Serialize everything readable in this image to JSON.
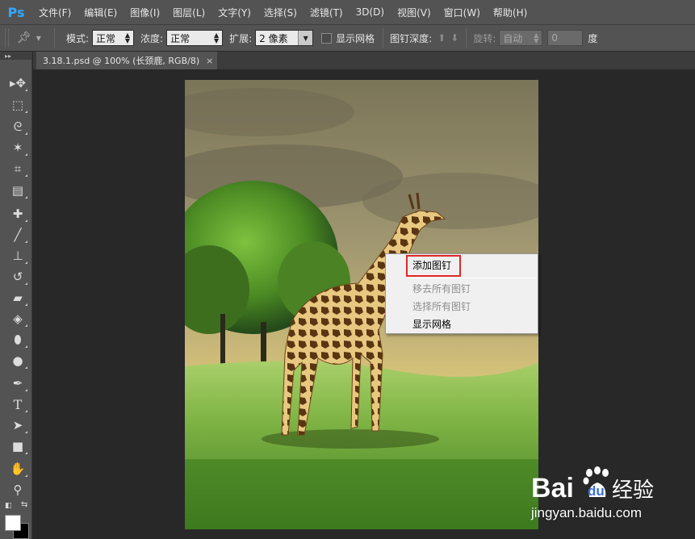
{
  "app": {
    "logo": "Ps"
  },
  "menu": [
    "文件(F)",
    "编辑(E)",
    "图像(I)",
    "图层(L)",
    "文字(Y)",
    "选择(S)",
    "滤镜(T)",
    "3D(D)",
    "视图(V)",
    "窗口(W)",
    "帮助(H)"
  ],
  "options": {
    "mode_label": "模式:",
    "mode_value": "正常",
    "density_label": "浓度:",
    "density_value": "正常",
    "expand_label": "扩展:",
    "expand_value": "2 像素",
    "show_mesh_label": "显示网格",
    "pin_depth_label": "图钉深度:",
    "rotate_label": "旋转:",
    "rotate_value": "自动",
    "rotate_angle": "0",
    "degree_label": "度"
  },
  "document": {
    "tab_title": "3.18.1.psd @ 100% (长颈鹿, RGB/8)",
    "close_glyph": "×"
  },
  "tools": [
    {
      "name": "move-tool",
      "icon": "move-icon",
      "glyph": "▸✥"
    },
    {
      "name": "marquee-tool",
      "icon": "rect-marquee-icon",
      "glyph": "⬚"
    },
    {
      "name": "lasso-tool",
      "icon": "lasso-icon",
      "glyph": "ᘓ"
    },
    {
      "name": "magic-wand-tool",
      "icon": "magic-wand-icon",
      "glyph": "✶"
    },
    {
      "name": "crop-tool",
      "icon": "crop-icon",
      "glyph": "⌗"
    },
    {
      "name": "eyedropper-tool",
      "icon": "eyedropper-icon",
      "glyph": "▤"
    },
    {
      "name": "healing-tool",
      "icon": "bandage-icon",
      "glyph": "✚"
    },
    {
      "name": "brush-tool",
      "icon": "brush-icon",
      "glyph": "╱"
    },
    {
      "name": "stamp-tool",
      "icon": "stamp-icon",
      "glyph": "⊥"
    },
    {
      "name": "history-brush-tool",
      "icon": "history-brush-icon",
      "glyph": "↺"
    },
    {
      "name": "eraser-tool",
      "icon": "eraser-icon",
      "glyph": "▰"
    },
    {
      "name": "paint-bucket-tool",
      "icon": "bucket-icon",
      "glyph": "◈"
    },
    {
      "name": "blur-tool",
      "icon": "blur-icon",
      "glyph": "⬮"
    },
    {
      "name": "dodge-tool",
      "icon": "dodge-icon",
      "glyph": "●"
    },
    {
      "name": "pen-tool",
      "icon": "pen-icon",
      "glyph": "✒"
    },
    {
      "name": "type-tool",
      "icon": "type-icon",
      "glyph": "T"
    },
    {
      "name": "path-select-tool",
      "icon": "path-select-icon",
      "glyph": "➤"
    },
    {
      "name": "shape-tool",
      "icon": "rectangle-icon",
      "glyph": "■"
    },
    {
      "name": "hand-tool",
      "icon": "hand-icon",
      "glyph": "✋"
    },
    {
      "name": "zoom-tool",
      "icon": "zoom-icon",
      "glyph": "⚲"
    }
  ],
  "context_menu": {
    "items": [
      {
        "label": "添加图钉",
        "enabled": true
      },
      {
        "label": "移去所有图钉",
        "enabled": false
      },
      {
        "label": "选择所有图钉",
        "enabled": false
      },
      {
        "label": "显示网格",
        "enabled": true
      }
    ]
  },
  "watermark": {
    "brand": "Bai",
    "brand2": "du",
    "brand3": "经验",
    "url": "jingyan.baidu.com"
  },
  "colors": {
    "highlight_box": "#e02828",
    "foreground": "#ffffff",
    "background": "#000000"
  }
}
